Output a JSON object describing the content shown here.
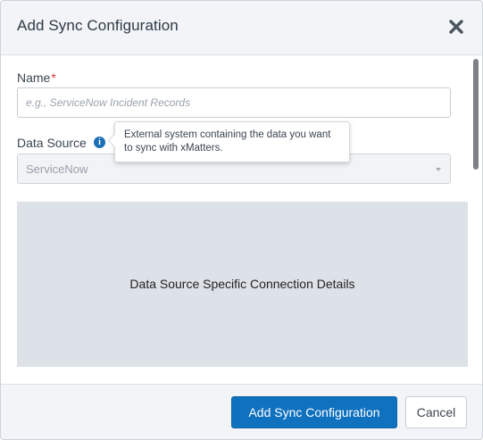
{
  "modal": {
    "title": "Add Sync Configuration",
    "close_icon": "close-icon"
  },
  "form": {
    "name_label": "Name",
    "name_required_marker": "*",
    "name_placeholder": "e.g., ServiceNow Incident Records",
    "name_value": "",
    "data_source_label": "Data Source",
    "data_source_info_icon": "info-icon",
    "data_source_tooltip": "External system containing the data you want to sync with xMatters.",
    "data_source_selected": "ServiceNow",
    "details_panel_text": "Data Source Specific Connection Details"
  },
  "footer": {
    "primary_label": "Add Sync Configuration",
    "cancel_label": "Cancel"
  },
  "colors": {
    "primary": "#1071bf",
    "required": "#d9303a",
    "info": "#1c6fb6",
    "header_bg": "#f2f4f7",
    "panel_bg": "#dde1e8"
  }
}
